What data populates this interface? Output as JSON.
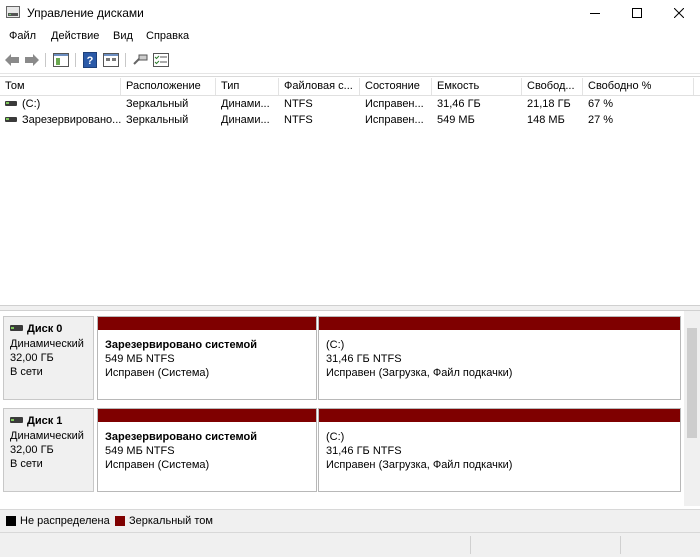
{
  "window": {
    "title": "Управление дисками"
  },
  "menu": [
    "Файл",
    "Действие",
    "Вид",
    "Справка"
  ],
  "colors": {
    "unallocated": "#000000",
    "mirrored": "#7f0000"
  },
  "volumes": {
    "columns": [
      "Том",
      "Расположение",
      "Тип",
      "Файловая с...",
      "Состояние",
      "Емкость",
      "Свобод...",
      "Свободно %"
    ],
    "rows": [
      [
        "(C:)",
        "Зеркальный",
        "Динами...",
        "NTFS",
        "Исправен...",
        "31,46 ГБ",
        "21,18 ГБ",
        "67 %"
      ],
      [
        "Зарезервировано...",
        "Зеркальный",
        "Динами...",
        "NTFS",
        "Исправен...",
        "549 МБ",
        "148 МБ",
        "27 %"
      ]
    ]
  },
  "disks": [
    {
      "name": "Диск 0",
      "type": "Динамический",
      "size": "32,00 ГБ",
      "status": "В сети",
      "partitions": [
        {
          "title": "Зарезервировано системой",
          "size": "549 МБ NTFS",
          "status": "Исправен (Система)"
        },
        {
          "title": "(C:)",
          "size": "31,46 ГБ NTFS",
          "status": "Исправен (Загрузка, Файл подкачки)"
        }
      ]
    },
    {
      "name": "Диск 1",
      "type": "Динамический",
      "size": "32,00 ГБ",
      "status": "В сети",
      "partitions": [
        {
          "title": "Зарезервировано системой",
          "size": "549 МБ NTFS",
          "status": "Исправен (Система)"
        },
        {
          "title": "(C:)",
          "size": "31,46 ГБ NTFS",
          "status": "Исправен (Загрузка, Файл подкачки)"
        }
      ]
    }
  ],
  "legend": {
    "unallocated": "Не распределена",
    "mirrored": "Зеркальный том"
  }
}
